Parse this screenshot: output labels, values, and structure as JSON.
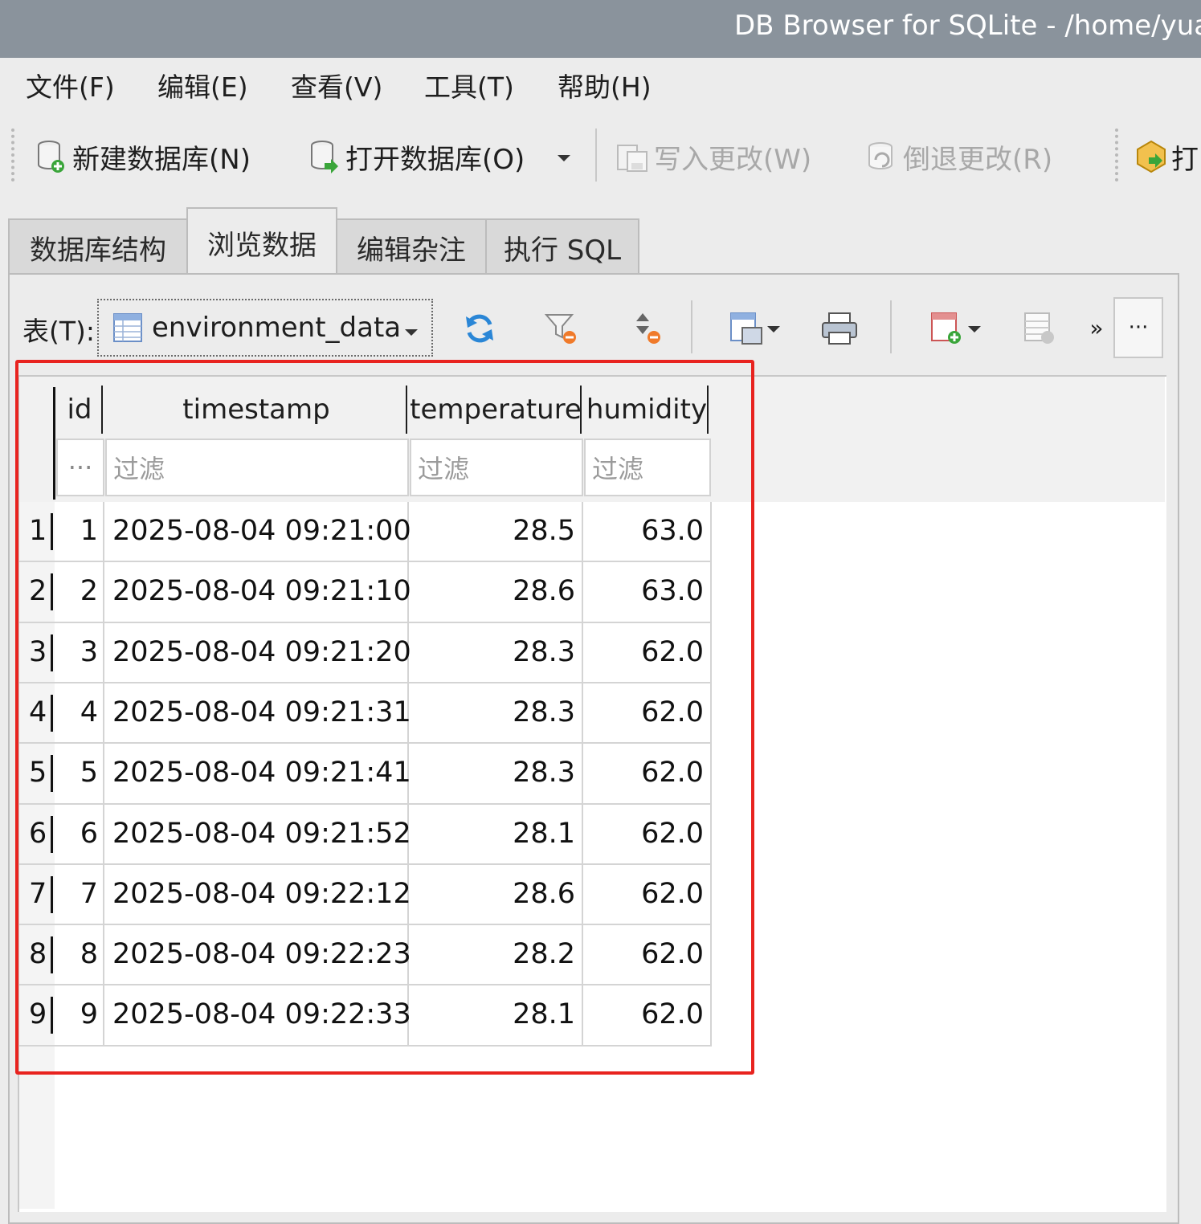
{
  "window": {
    "title": "DB Browser for SQLite - /home/yua"
  },
  "menu": [
    "文件(F)",
    "编辑(E)",
    "查看(V)",
    "工具(T)",
    "帮助(H)"
  ],
  "toolbar": {
    "new_db": "新建数据库(N)",
    "open_db": "打开数据库(O)",
    "write_changes": "写入更改(W)",
    "revert_changes": "倒退更改(R)",
    "open_project_partial": "打"
  },
  "tabs": [
    "数据库结构",
    "浏览数据",
    "编辑杂注",
    "执行 SQL"
  ],
  "browse": {
    "table_label": "表(T):",
    "table_name": "environment_data",
    "more_label": "»",
    "ellipsis": "···"
  },
  "grid": {
    "columns": [
      "id",
      "timestamp",
      "temperature",
      "humidity"
    ],
    "filter_placeholder": "过滤",
    "id_filter_text": "···",
    "rows": [
      {
        "rownum": "1",
        "id": "1",
        "timestamp": "2025-08-04 09:21:00",
        "temperature": "28.5",
        "humidity": "63.0"
      },
      {
        "rownum": "2",
        "id": "2",
        "timestamp": "2025-08-04 09:21:10",
        "temperature": "28.6",
        "humidity": "63.0"
      },
      {
        "rownum": "3",
        "id": "3",
        "timestamp": "2025-08-04 09:21:20",
        "temperature": "28.3",
        "humidity": "62.0"
      },
      {
        "rownum": "4",
        "id": "4",
        "timestamp": "2025-08-04 09:21:31",
        "temperature": "28.3",
        "humidity": "62.0"
      },
      {
        "rownum": "5",
        "id": "5",
        "timestamp": "2025-08-04 09:21:41",
        "temperature": "28.3",
        "humidity": "62.0"
      },
      {
        "rownum": "6",
        "id": "6",
        "timestamp": "2025-08-04 09:21:52",
        "temperature": "28.1",
        "humidity": "62.0"
      },
      {
        "rownum": "7",
        "id": "7",
        "timestamp": "2025-08-04 09:22:12",
        "temperature": "28.6",
        "humidity": "62.0"
      },
      {
        "rownum": "8",
        "id": "8",
        "timestamp": "2025-08-04 09:22:23",
        "temperature": "28.2",
        "humidity": "62.0"
      },
      {
        "rownum": "9",
        "id": "9",
        "timestamp": "2025-08-04 09:22:33",
        "temperature": "28.1",
        "humidity": "62.0"
      }
    ]
  },
  "colors": {
    "highlight_box": "#e8231f",
    "titlebar": "#8a939c"
  }
}
